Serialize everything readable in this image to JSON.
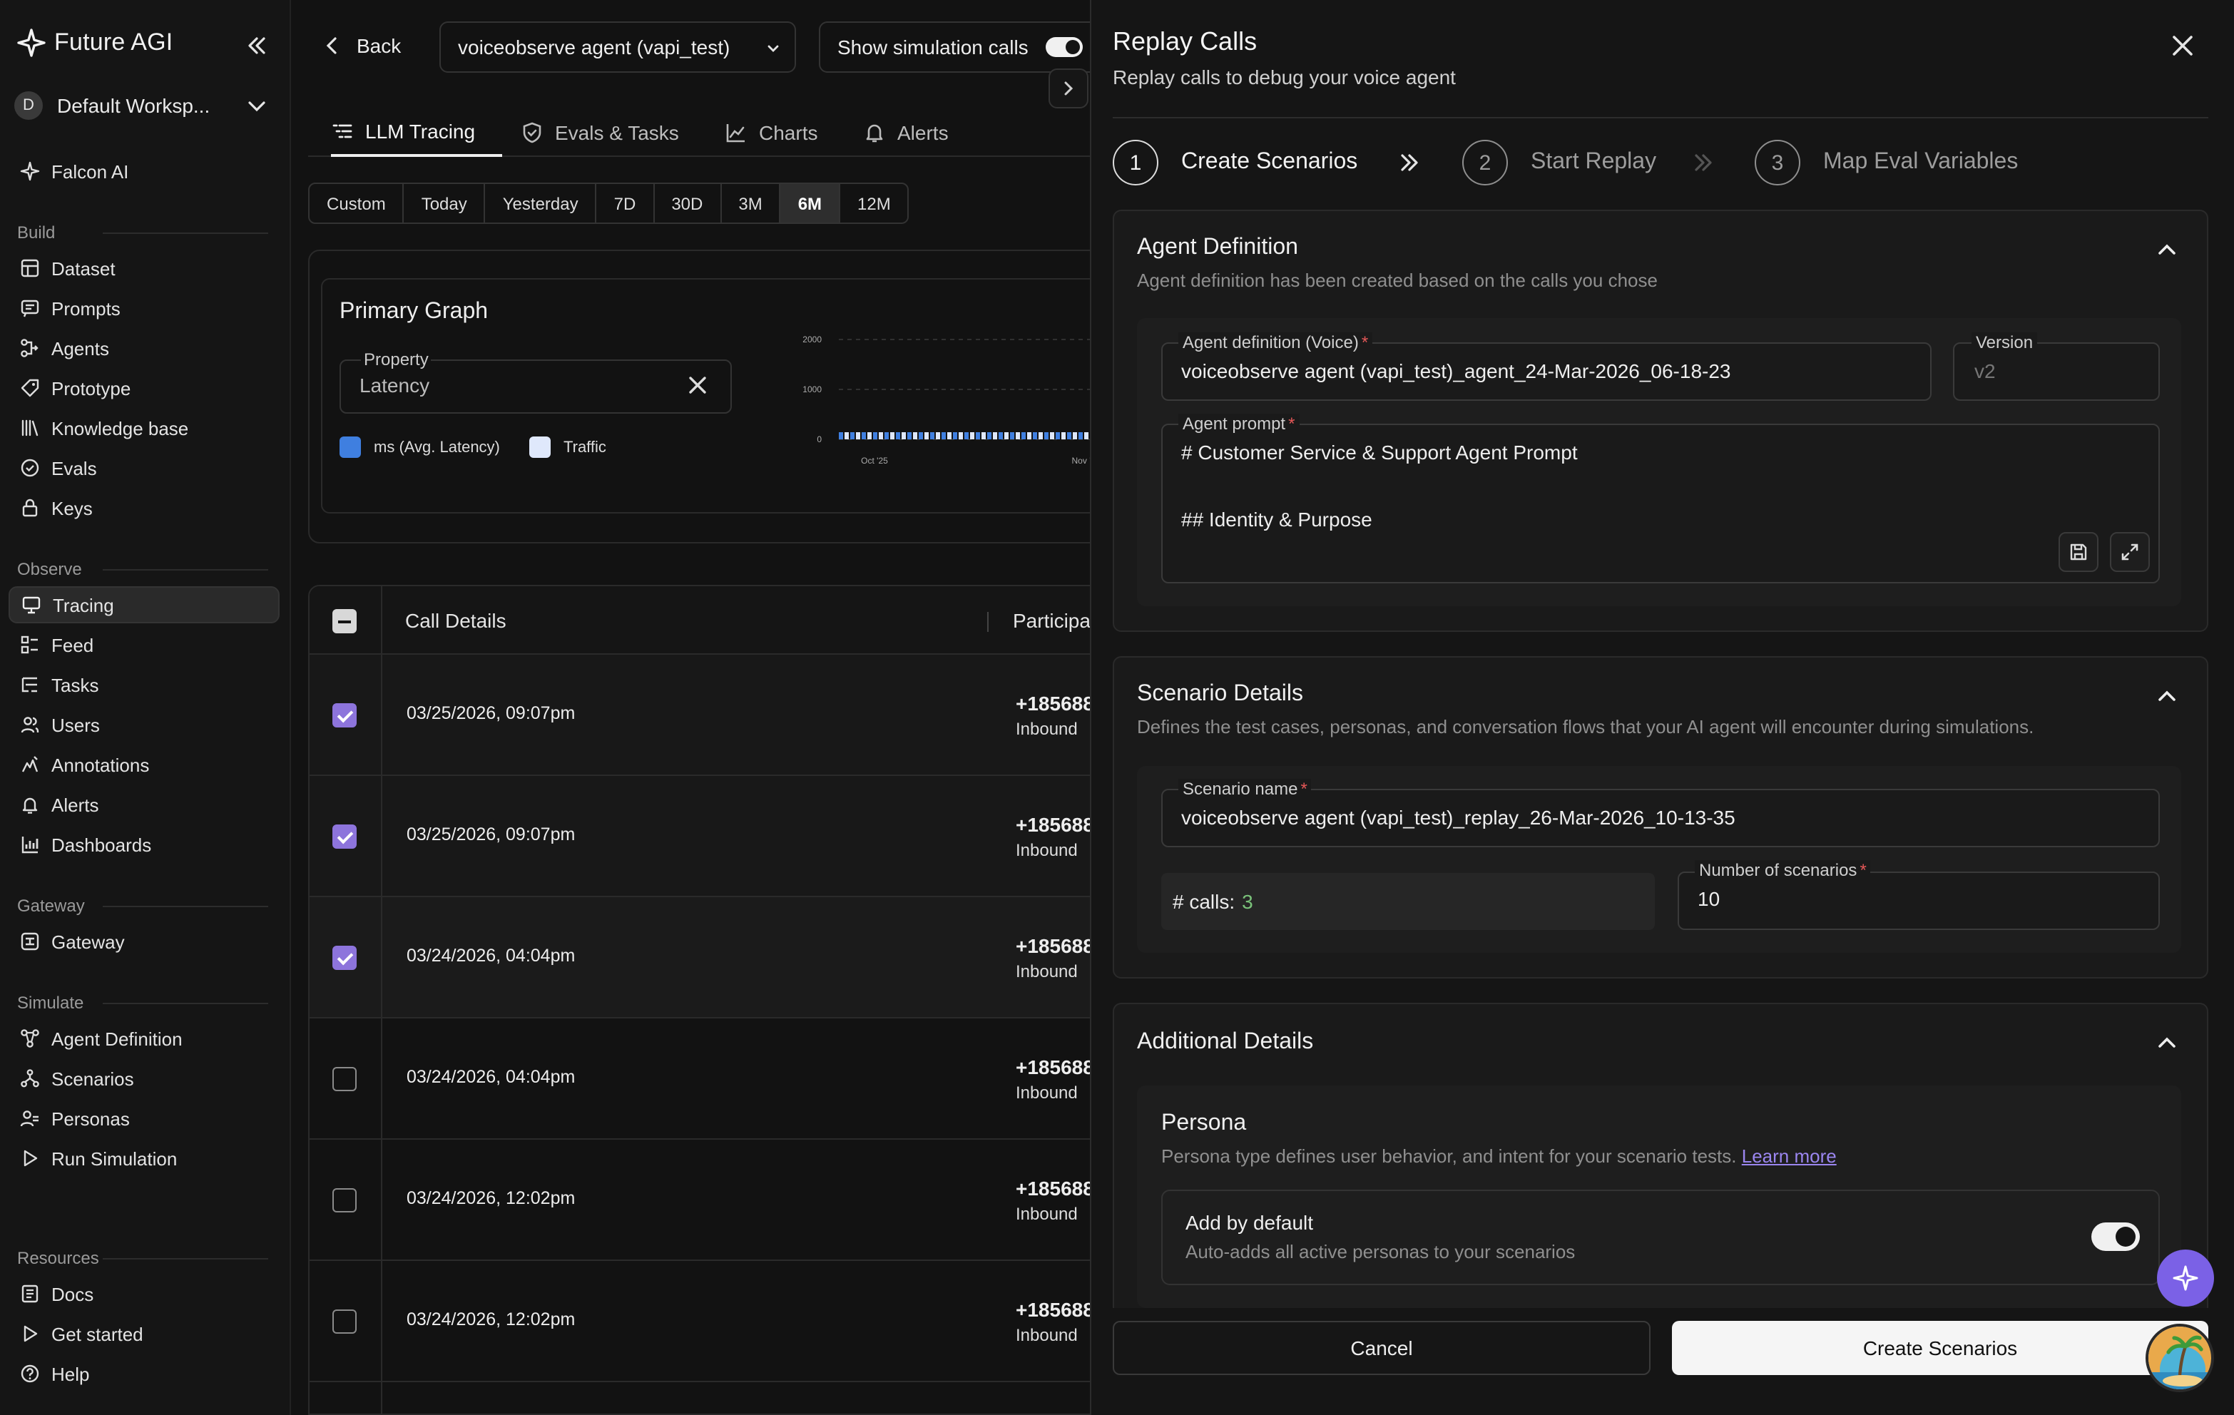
{
  "app": {
    "brand": "Future AGI"
  },
  "workspace": {
    "initial": "D",
    "name": "Default Worksp..."
  },
  "sidebar": {
    "top": [
      {
        "label": "Falcon AI",
        "icon": "sparkle-icon"
      }
    ],
    "sections": [
      {
        "title": "Build",
        "items": [
          {
            "label": "Dataset",
            "icon": "grid-icon"
          },
          {
            "label": "Prompts",
            "icon": "message-icon"
          },
          {
            "label": "Agents",
            "icon": "flow-icon"
          },
          {
            "label": "Prototype",
            "icon": "tag-icon"
          },
          {
            "label": "Knowledge base",
            "icon": "library-icon"
          },
          {
            "label": "Evals",
            "icon": "check-circle-icon"
          },
          {
            "label": "Keys",
            "icon": "lock-icon"
          }
        ]
      },
      {
        "title": "Observe",
        "items": [
          {
            "label": "Tracing",
            "icon": "monitor-icon",
            "active": true
          },
          {
            "label": "Feed",
            "icon": "feed-icon"
          },
          {
            "label": "Tasks",
            "icon": "tasks-icon"
          },
          {
            "label": "Users",
            "icon": "users-icon"
          },
          {
            "label": "Annotations",
            "icon": "annotation-icon"
          },
          {
            "label": "Alerts",
            "icon": "bell-icon"
          },
          {
            "label": "Dashboards",
            "icon": "bar-chart-icon"
          }
        ]
      },
      {
        "title": "Gateway",
        "items": [
          {
            "label": "Gateway",
            "icon": "gateway-icon"
          }
        ]
      },
      {
        "title": "Simulate",
        "items": [
          {
            "label": "Agent Definition",
            "icon": "nodes-icon"
          },
          {
            "label": "Scenarios",
            "icon": "branches-icon"
          },
          {
            "label": "Personas",
            "icon": "persona-icon"
          },
          {
            "label": "Run Simulation",
            "icon": "play-icon"
          }
        ]
      },
      {
        "title": "Resources",
        "items": [
          {
            "label": "Docs",
            "icon": "docs-icon"
          },
          {
            "label": "Get started",
            "icon": "play-icon"
          },
          {
            "label": "Help",
            "icon": "help-icon"
          }
        ]
      }
    ]
  },
  "topbar": {
    "back_label": "Back",
    "agent_select": "voiceobserve agent (vapi_test)",
    "sim_toggle_label": "Show simulation calls",
    "sim_toggle_on": true
  },
  "tabs": [
    {
      "label": "LLM Tracing",
      "active": true
    },
    {
      "label": "Evals & Tasks"
    },
    {
      "label": "Charts"
    },
    {
      "label": "Alerts"
    }
  ],
  "date_ranges": [
    "Custom",
    "Today",
    "Yesterday",
    "7D",
    "30D",
    "3M",
    "6M",
    "12M"
  ],
  "date_range_active": "6M",
  "graph": {
    "title": "Primary Graph",
    "property_label": "Property",
    "property_value": "Latency",
    "legend": [
      {
        "label": "ms (Avg. Latency)",
        "color": "#3f7fe0"
      },
      {
        "label": "Traffic",
        "color": "#dfe8fb"
      }
    ]
  },
  "chart_data": {
    "type": "bar",
    "y_ticks": [
      "2000",
      "1000",
      "0"
    ],
    "ylim": [
      0,
      2000
    ],
    "x_ticks": [
      "Oct '25",
      "Nov '"
    ],
    "series": [
      {
        "name": "ms (Avg. Latency)"
      },
      {
        "name": "Traffic"
      }
    ]
  },
  "table": {
    "headers": [
      "Call Details",
      "Participa"
    ],
    "rows": [
      {
        "date": "03/25/2026, 09:07pm",
        "phone": "+185688",
        "direction": "Inbound",
        "checked": true
      },
      {
        "date": "03/25/2026, 09:07pm",
        "phone": "+185688",
        "direction": "Inbound",
        "checked": true
      },
      {
        "date": "03/24/2026, 04:04pm",
        "phone": "+185688",
        "direction": "Inbound",
        "checked": true
      },
      {
        "date": "03/24/2026, 04:04pm",
        "phone": "+185688",
        "direction": "Inbound",
        "checked": false
      },
      {
        "date": "03/24/2026, 12:02pm",
        "phone": "+185688",
        "direction": "Inbound",
        "checked": false
      },
      {
        "date": "03/24/2026, 12:02pm",
        "phone": "+185688",
        "direction": "Inbound",
        "checked": false
      }
    ]
  },
  "panel": {
    "title": "Replay Calls",
    "subtitle": "Replay calls to debug your voice agent",
    "steps": [
      {
        "num": "1",
        "label": "Create Scenarios",
        "active": true
      },
      {
        "num": "2",
        "label": "Start Replay"
      },
      {
        "num": "3",
        "label": "Map Eval Variables"
      }
    ],
    "agent_definition": {
      "title": "Agent Definition",
      "desc": "Agent definition has been created based on the calls you chose",
      "def_label": "Agent definition (Voice)",
      "def_value": "voiceobserve agent (vapi_test)_agent_24-Mar-2026_06-18-23",
      "version_label": "Version",
      "version_value": "v2",
      "prompt_label": "Agent prompt",
      "prompt_line1": "# Customer Service & Support Agent Prompt",
      "prompt_line2": "## Identity & Purpose"
    },
    "scenario_details": {
      "title": "Scenario Details",
      "desc": "Defines the test cases, personas, and conversation flows that your AI agent will encounter during simulations.",
      "name_label": "Scenario name",
      "name_value": "voiceobserve agent (vapi_test)_replay_26-Mar-2026_10-13-35",
      "calls_label": "# calls:",
      "calls_value": "3",
      "num_label": "Number of scenarios",
      "num_value": "10"
    },
    "additional": {
      "title": "Additional Details",
      "persona_title": "Persona",
      "persona_desc": "Persona type defines user behavior, and intent for your scenario tests.",
      "learn_more": "Learn more",
      "default_title": "Add by default",
      "default_desc": "Auto-adds all active personas to your scenarios",
      "default_on": true
    },
    "cancel_label": "Cancel",
    "create_label": "Create Scenarios"
  }
}
